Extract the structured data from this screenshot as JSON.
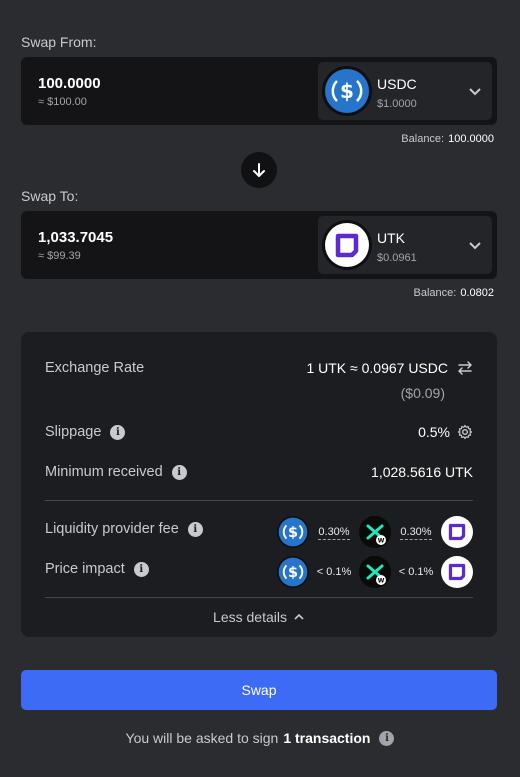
{
  "swap_from": {
    "label": "Swap From:",
    "amount": "100.0000",
    "usd_value": "≈ $100.00",
    "token_symbol": "USDC",
    "token_price": "$1.0000",
    "balance_label": "Balance:",
    "balance_value": "100.0000"
  },
  "swap_to": {
    "label": "Swap To:",
    "amount": "1,033.7045",
    "usd_value": "≈ $99.39",
    "token_symbol": "UTK",
    "token_price": "$0.0961",
    "balance_label": "Balance:",
    "balance_value": "0.0802"
  },
  "details": {
    "exchange_rate_label": "Exchange Rate",
    "exchange_rate_value": "1 UTK ≈ 0.0967 USDC",
    "exchange_rate_usd": "($0.09)",
    "slippage_label": "Slippage",
    "slippage_value": "0.5%",
    "min_received_label": "Minimum received",
    "min_received_value": "1,028.5616 UTK",
    "lp_fee_label": "Liquidity provider fee",
    "lp_fee_hop1": "0.30%",
    "lp_fee_hop2": "0.30%",
    "price_impact_label": "Price impact",
    "price_impact_hop1": "< 0.1%",
    "price_impact_hop2": "< 0.1%",
    "less_details_label": "Less details"
  },
  "swap_button_label": "Swap",
  "sign_note": {
    "prefix": "You will be asked to sign",
    "count": "1 transaction"
  },
  "colors": {
    "background": "#2b2c2f",
    "panel": "#1c1d20",
    "input_bg": "#141416",
    "accent": "#3d6bf5",
    "usdc_blue": "#2775ca",
    "utk_purple": "#5b2bd1",
    "bridge_teal": "#1de9b6"
  },
  "icons": [
    "usdc-logo",
    "utk-logo",
    "chevron-down-icon",
    "arrow-down-icon",
    "swap-arrows-icon",
    "info-icon",
    "gear-icon",
    "chevron-up-icon",
    "bridge-logo"
  ]
}
